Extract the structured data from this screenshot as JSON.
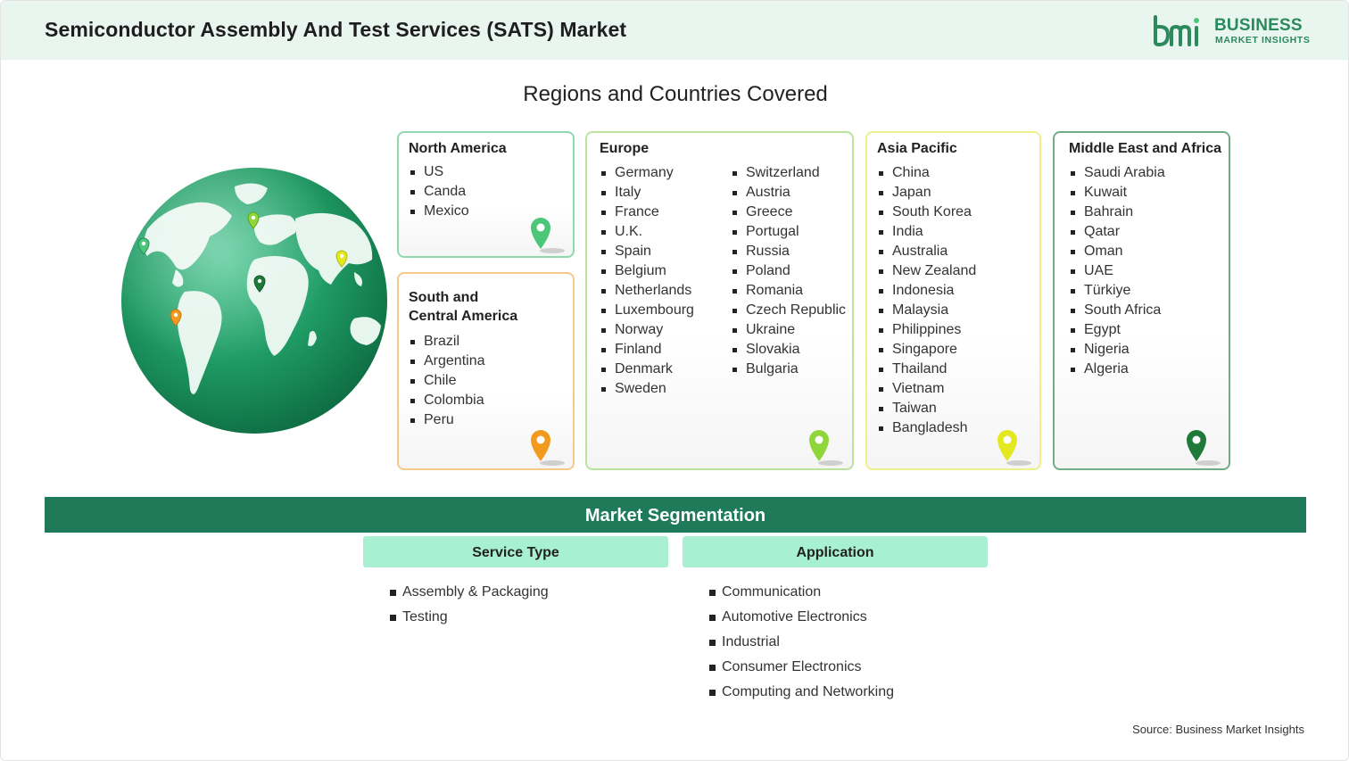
{
  "header": {
    "title": "Semiconductor Assembly And Test Services (SATS) Market",
    "logo_line1": "BUSINESS",
    "logo_line2": "MARKET INSIGHTS"
  },
  "regions_title": "Regions and Countries Covered",
  "regions": {
    "north_america": {
      "name": "North America",
      "countries": [
        "US",
        "Canda",
        "Mexico"
      ],
      "pin_color": "#4cc77a"
    },
    "south_america": {
      "name_line1": "South and",
      "name_line2": "Central America",
      "countries": [
        "Brazil",
        "Argentina",
        "Chile",
        "Colombia",
        "Peru"
      ],
      "pin_color": "#f29a1f"
    },
    "europe": {
      "name": "Europe",
      "countries_col1": [
        "Germany",
        "Italy",
        "France",
        "U.K.",
        "Spain",
        "Belgium",
        "Netherlands",
        "Luxembourg",
        "Norway",
        "Finland",
        "Denmark",
        "Sweden"
      ],
      "countries_col2": [
        "Switzerland",
        "Austria",
        "Greece",
        "Portugal",
        "Russia",
        "Poland",
        "Romania",
        "Czech Republic",
        "Ukraine",
        "Slovakia",
        "Bulgaria"
      ],
      "pin_color": "#8fd63a"
    },
    "asia_pacific": {
      "name": "Asia Pacific",
      "countries": [
        "China",
        "Japan",
        "South Korea",
        "India",
        "Australia",
        "New Zealand",
        "Indonesia",
        "Malaysia",
        "Philippines",
        "Singapore",
        "Thailand",
        "Vietnam",
        "Taiwan",
        "Bangladesh"
      ],
      "pin_color": "#e4e81e"
    },
    "mea": {
      "name": "Middle East and Africa",
      "countries": [
        "Saudi Arabia",
        "Kuwait",
        "Bahrain",
        "Qatar",
        "Oman",
        "UAE",
        "Türkiye",
        "South Africa",
        "Egypt",
        "Nigeria",
        "Algeria"
      ],
      "pin_color": "#1f7a3a"
    }
  },
  "segmentation": {
    "title": "Market Segmentation",
    "service_type": {
      "label": "Service Type",
      "items": [
        "Assembly & Packaging",
        "Testing"
      ]
    },
    "application": {
      "label": "Application",
      "items": [
        "Communication",
        "Automotive Electronics",
        "Industrial",
        "Consumer Electronics",
        "Computing and Networking"
      ]
    }
  },
  "source": "Source: Business Market Insights",
  "colors": {
    "brand_green": "#2a8a5c",
    "banner_green": "#1f7a5a",
    "segment_head": "#a7f0d1",
    "card_border_na": "#8fd9b0",
    "card_border_sa": "#f6c98a",
    "card_border_eu": "#b9e49a",
    "card_border_ap": "#eef08a",
    "card_border_mea": "#6fae85"
  }
}
